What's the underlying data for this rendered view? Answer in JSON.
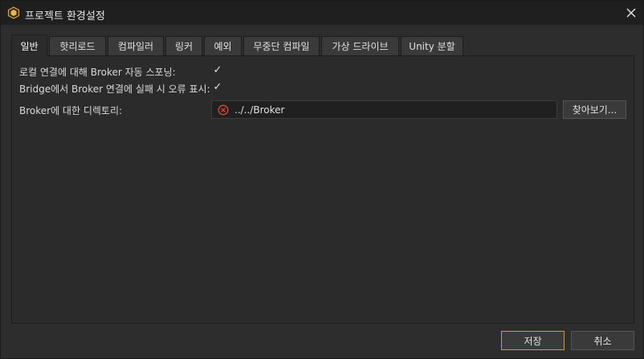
{
  "window": {
    "title": "프로젝트 환경설정",
    "app_icon": "app-logo-icon",
    "close_icon": "close-icon"
  },
  "tabs": [
    {
      "label": "일반",
      "active": true
    },
    {
      "label": "핫리로드",
      "active": false
    },
    {
      "label": "컴파일러",
      "active": false
    },
    {
      "label": "링커",
      "active": false
    },
    {
      "label": "예외",
      "active": false
    },
    {
      "label": "무중단 컴파일",
      "active": false
    },
    {
      "label": "가상 드라이브",
      "active": false
    },
    {
      "label": "Unity 분할",
      "active": false
    }
  ],
  "general": {
    "local_spawn": {
      "label": "로컬 연결에 대해 Broker 자동 스포닝:",
      "checked": true
    },
    "show_error": {
      "label": "Bridge에서 Broker 연결에 실패 시 오류 표시:",
      "checked": true
    },
    "broker_dir": {
      "label": "Broker에 대한 디렉토리:",
      "value": "../../Broker",
      "status_icon": "error-icon"
    },
    "browse_label": "찾아보기..."
  },
  "footer": {
    "save_label": "저장",
    "cancel_label": "취소"
  },
  "colors": {
    "accent": "#c89a4a",
    "error": "#e0463c",
    "background": "#2d2d2d"
  }
}
